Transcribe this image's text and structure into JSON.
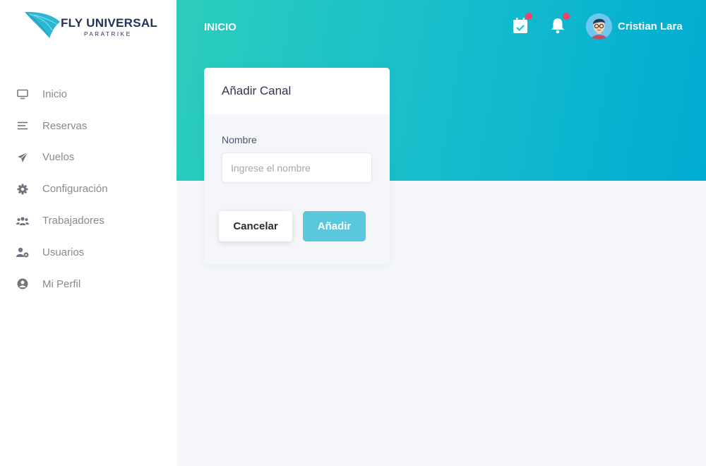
{
  "brand": {
    "name": "FLY UNIVERSAL",
    "subtitle": "PARATRIKE"
  },
  "sidebar": {
    "items": [
      {
        "label": "Inicio",
        "icon": "monitor-icon"
      },
      {
        "label": "Reservas",
        "icon": "menu-lines-icon"
      },
      {
        "label": "Vuelos",
        "icon": "paper-plane-icon"
      },
      {
        "label": "Configuración",
        "icon": "gear-icon"
      },
      {
        "label": "Trabajadores",
        "icon": "users-icon"
      },
      {
        "label": "Usuarios",
        "icon": "user-cog-icon"
      },
      {
        "label": "Mi Perfil",
        "icon": "user-circle-icon"
      }
    ]
  },
  "header": {
    "title": "INICIO",
    "calendar_icon": "calendar-check-icon",
    "bell_icon": "bell-icon",
    "user_name": "Cristian Lara"
  },
  "card": {
    "title": "Añadir Canal",
    "field_label": "Nombre",
    "field_placeholder": "Ingrese el nombre",
    "field_value": "",
    "cancel_label": "Cancelar",
    "add_label": "Añadir"
  },
  "colors": {
    "header_gradient_start": "#2dcdbd",
    "header_gradient_end": "#00abd1",
    "add_button": "#5ac8dc",
    "notification_dot": "#f0446b",
    "brand_text": "#243158"
  }
}
